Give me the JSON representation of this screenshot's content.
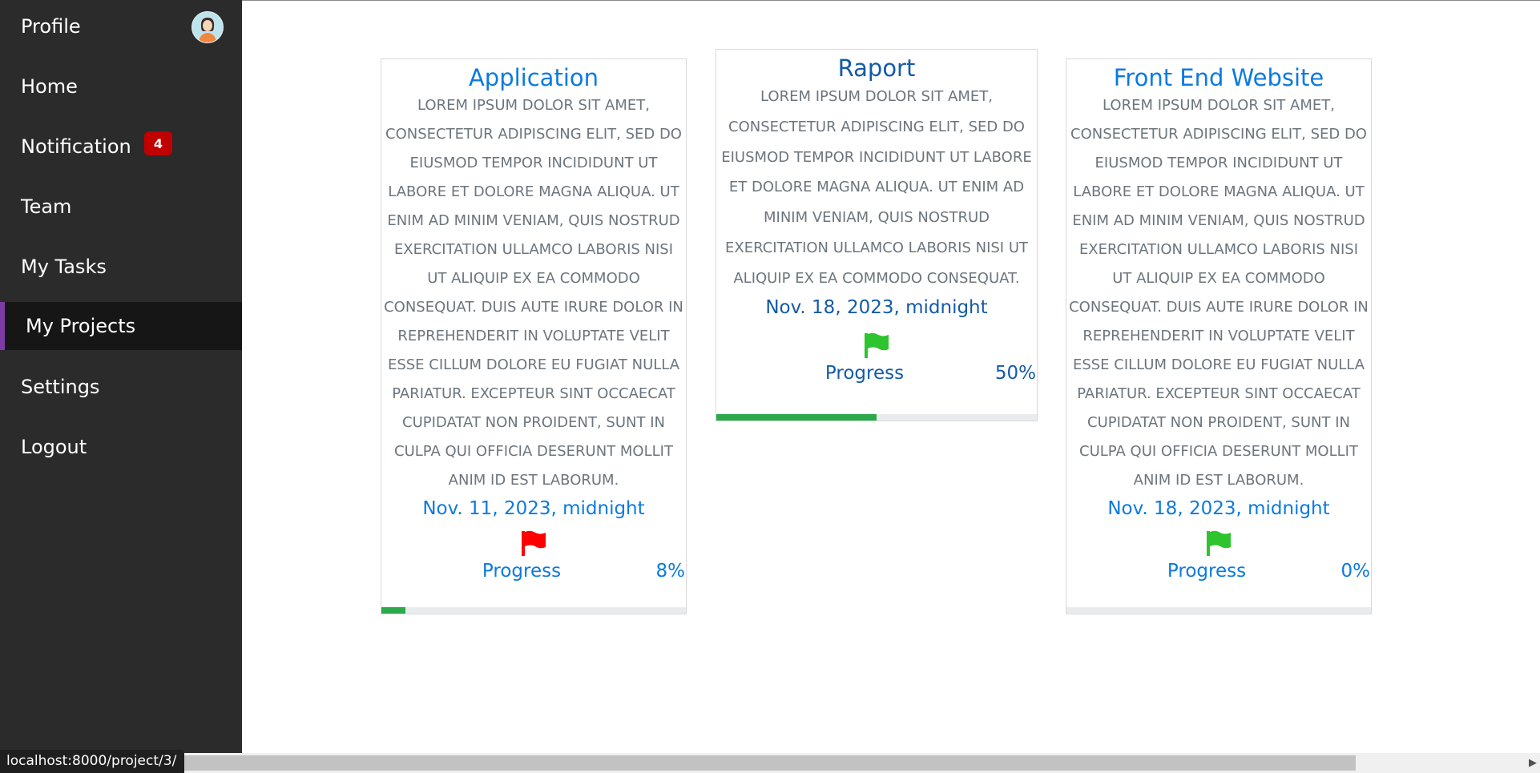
{
  "sidebar": {
    "items": [
      {
        "label": "Profile"
      },
      {
        "label": "Home"
      },
      {
        "label": "Notification"
      },
      {
        "label": "Team"
      },
      {
        "label": "My Tasks"
      },
      {
        "label": "My Projects"
      },
      {
        "label": "Settings"
      },
      {
        "label": "Logout"
      }
    ],
    "notification_count": "4",
    "active_item": "My Projects",
    "avatar_icon": "user-avatar-icon"
  },
  "projects": [
    {
      "title": "Application",
      "description": "Lorem ipsum dolor sit amet, consectetur adipiscing elit, sed do eiusmod tempor incididunt ut labore et dolore magna aliqua. Ut enim ad minim veniam, quis nostrud exercitation ullamco laboris nisi ut aliquip ex ea commodo consequat. Duis aute irure dolor in reprehenderit in voluptate velit esse cillum dolore eu fugiat nulla pariatur. Excepteur sint occaecat cupidatat non proident, sunt in culpa qui officia deserunt mollit anim id est laborum.",
      "due_date": "Nov. 11, 2023, midnight",
      "flag_icon": "red-flag-icon",
      "flag_color": "#ff0000",
      "progress_label": "Progress",
      "progress_percent": "8%",
      "progress_value": 8
    },
    {
      "title": "Raport",
      "description": "Lorem ipsum dolor sit amet, consectetur adipiscing elit, sed do eiusmod tempor incididunt ut labore et dolore magna aliqua. Ut enim ad minim veniam, quis nostrud exercitation ullamco laboris nisi ut aliquip ex ea commodo consequat.",
      "due_date": "Nov. 18, 2023, midnight",
      "flag_icon": "green-flag-icon",
      "flag_color": "#2ec42e",
      "progress_label": "Progress",
      "progress_percent": "50%",
      "progress_value": 50
    },
    {
      "title": "Front End Website",
      "description": "Lorem ipsum dolor sit amet, consectetur adipiscing elit, sed do eiusmod tempor incididunt ut labore et dolore magna aliqua. Ut enim ad minim veniam, quis nostrud exercitation ullamco laboris nisi ut aliquip ex ea commodo consequat. Duis aute irure dolor in reprehenderit in voluptate velit esse cillum dolore eu fugiat nulla pariatur. Excepteur sint occaecat cupidatat non proident, sunt in culpa qui officia deserunt mollit anim id est laborum.",
      "due_date": "Nov. 18, 2023, midnight",
      "flag_icon": "green-flag-icon",
      "flag_color": "#2ec42e",
      "progress_label": "Progress",
      "progress_percent": "0%",
      "progress_value": 0
    }
  ],
  "status_bar": {
    "url": "localhost:8000/project/3/"
  },
  "colors": {
    "sidebar_bg": "#2b2b2b",
    "active_accent": "#7e3ba4",
    "link_blue": "#0c7ae0",
    "progress_green": "#2ba94b",
    "badge_red": "#c00000"
  }
}
